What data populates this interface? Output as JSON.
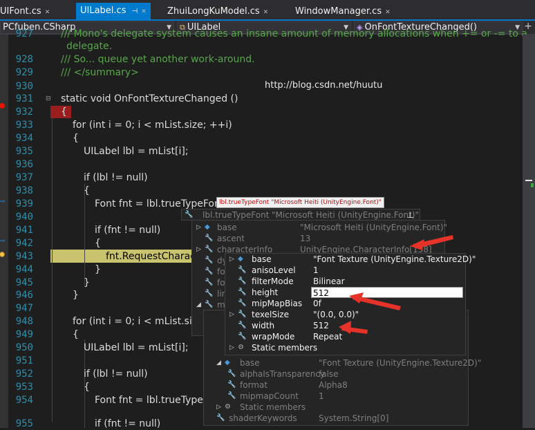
{
  "tabs": [
    {
      "label": "UIFont.cs",
      "active": false
    },
    {
      "label": "UILabel.cs",
      "active": true
    },
    {
      "label": "ZhuiLongKuModel.cs",
      "active": false
    },
    {
      "label": "WindowManager.cs",
      "active": false
    }
  ],
  "navbar": {
    "project": "PCfuben.CSharp",
    "class": "UILabel",
    "member": "OnFontTextureChanged()"
  },
  "code": [
    {
      "num": "927",
      "text": "/// Mono's delegate system causes an insane amount of memory allocations when += or -= to a"
    },
    {
      "num": "",
      "text": "delegate."
    },
    {
      "num": "928",
      "text": "/// So... queue yet another work-around."
    },
    {
      "num": "929",
      "text": "/// </summary>"
    },
    {
      "num": "930",
      "text": ""
    },
    {
      "num": "931",
      "text": "static void OnFontTextureChanged ()"
    },
    {
      "num": "932",
      "text": "{"
    },
    {
      "num": "933",
      "text": "for (int i = 0; i < mList.size; ++i)"
    },
    {
      "num": "934",
      "text": "{"
    },
    {
      "num": "935",
      "text": "UILabel lbl = mList[i];"
    },
    {
      "num": "936",
      "text": ""
    },
    {
      "num": "937",
      "text": "if (lbl != null)"
    },
    {
      "num": "938",
      "text": "{"
    },
    {
      "num": "939",
      "text": "Font fnt = lbl.trueTypeFont;"
    },
    {
      "num": "940",
      "text": ""
    },
    {
      "num": "941",
      "text": "if (fnt != null)"
    },
    {
      "num": "942",
      "text": "{"
    },
    {
      "num": "943",
      "text": "fnt.RequestCharacte"
    },
    {
      "num": "944",
      "text": "}"
    },
    {
      "num": "945",
      "text": "}"
    },
    {
      "num": "946",
      "text": "}"
    },
    {
      "num": "947",
      "text": ""
    },
    {
      "num": "948",
      "text": "for (int i = 0; i < mList.size;"
    },
    {
      "num": "949",
      "text": "{"
    },
    {
      "num": "950",
      "text": "UILabel lbl = mList[i];"
    },
    {
      "num": "951",
      "text": ""
    },
    {
      "num": "952",
      "text": "if (lbl != null)"
    },
    {
      "num": "953",
      "text": "{"
    },
    {
      "num": "954",
      "text": "Font fnt = lbl.trueTypeFo"
    },
    {
      "num": "955",
      "text": "if (fnt != null)"
    }
  ],
  "watermark": "http://blog.csdn.net/huutu",
  "datatip1": {
    "name": "lbl.trueTypeFont",
    "value": "\"Microsoft Heiti (UnityEngine.Font)\""
  },
  "datatip2": {
    "header_name": "lbl.trueTypeFont",
    "header_value": "\"Microsoft Heiti (UnityEngine.Font)\"",
    "rows": [
      {
        "name": "base",
        "value": "\"Microsoft Heiti (UnityEngine.Font)\""
      },
      {
        "name": "ascent",
        "value": "13"
      },
      {
        "name": "characterInfo",
        "value": "UnityEngine.CharacterInfo[158]"
      },
      {
        "name": "dy",
        "value": ""
      },
      {
        "name": "for",
        "value": ""
      },
      {
        "name": "for",
        "value": ""
      },
      {
        "name": "lin",
        "value": ""
      },
      {
        "name": "ma",
        "value": ""
      }
    ]
  },
  "datatip3": {
    "rows": [
      {
        "name": "base",
        "value": "\"Font Texture (UnityEngine.Texture2D)\""
      },
      {
        "name": "anisoLevel",
        "value": "1"
      },
      {
        "name": "filterMode",
        "value": "Bilinear"
      },
      {
        "name": "height",
        "value": "512"
      },
      {
        "name": "mipMapBias",
        "value": "0f"
      },
      {
        "name": "texelSize",
        "value": "\"(0.0, 0.0)\""
      },
      {
        "name": "width",
        "value": "512"
      },
      {
        "name": "wrapMode",
        "value": "Repeat"
      },
      {
        "name": "Static members",
        "value": ""
      }
    ]
  },
  "datatip4": {
    "rows": [
      {
        "name": "base",
        "value": "\"Font Texture (UnityEngine.Texture2D)\""
      },
      {
        "name": "alphaIsTransparency",
        "value": "false"
      },
      {
        "name": "format",
        "value": "Alpha8"
      },
      {
        "name": "mipmapCount",
        "value": "1"
      },
      {
        "name": "Static members",
        "value": ""
      },
      {
        "name": "shaderKeywords",
        "value": "System.String[0]"
      }
    ]
  },
  "colors": {
    "accent": "#007acc",
    "annotation_arrow": "#e5332a"
  }
}
